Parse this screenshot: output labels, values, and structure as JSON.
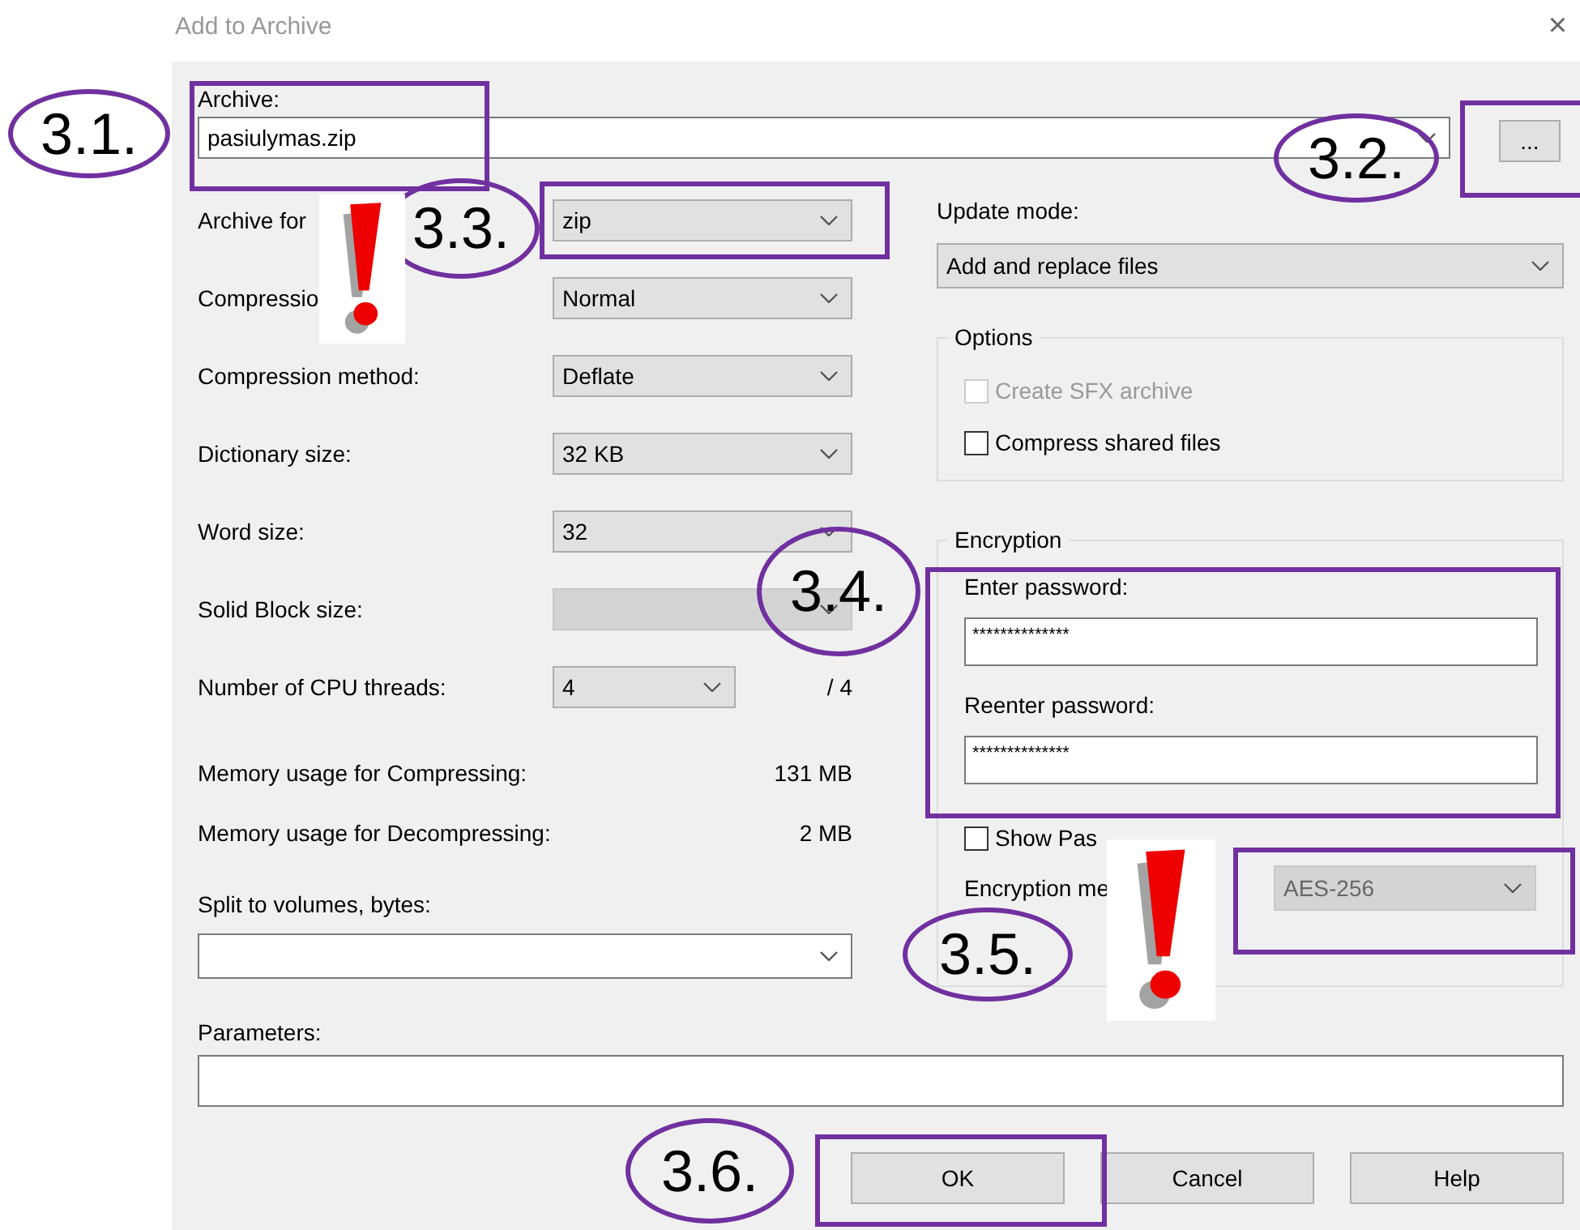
{
  "window": {
    "title": "Add to Archive",
    "close": "×"
  },
  "archive": {
    "label": "Archive:",
    "value": "pasiulymas.zip",
    "browse": "..."
  },
  "settings": [
    {
      "kind": "combo",
      "label": "Archive for",
      "value": "zip",
      "disabled": false
    },
    {
      "kind": "combo",
      "label": "Compressio",
      "value": "Normal",
      "disabled": false
    },
    {
      "kind": "combo",
      "label": "Compression method:",
      "value": "Deflate",
      "disabled": false
    },
    {
      "kind": "combo",
      "label": "Dictionary size:",
      "value": "32 KB",
      "disabled": false
    },
    {
      "kind": "combo",
      "label": "Word size:",
      "value": "32",
      "disabled": false
    },
    {
      "kind": "combo",
      "label": "Solid Block size:",
      "disabled": true
    },
    {
      "kind": "threads",
      "label": "Number of CPU threads:",
      "value": "4",
      "suffix": "/ 4",
      "disabled": false
    },
    {
      "kind": "info",
      "label": "Memory usage for Compressing:",
      "value": "131 MB"
    },
    {
      "kind": "info",
      "label": "Memory usage for Decompressing:",
      "value": "2 MB"
    }
  ],
  "split": {
    "label": "Split to volumes, bytes:"
  },
  "parameters": {
    "label": "Parameters:"
  },
  "update_mode": {
    "label": "Update mode:",
    "value": "Add and replace files"
  },
  "options": {
    "title": "Options",
    "items": [
      {
        "label": "Create SFX archive",
        "checked": false,
        "disabled": true
      },
      {
        "label": "Compress shared files",
        "checked": false,
        "disabled": false
      }
    ]
  },
  "encryption": {
    "title": "Encryption",
    "password_label": "Enter password:",
    "password": "**************",
    "reenter_label": "Reenter password:",
    "reenter": "**************",
    "show_password": {
      "label": "Show Pas",
      "checked": false
    },
    "method_label": "Encryption me",
    "method": {
      "value": "AES-256",
      "disabled": true
    }
  },
  "buttons": [
    "OK",
    "Cancel",
    "Help"
  ],
  "annotations": [
    {
      "kind": "callout",
      "label": "3.1."
    },
    {
      "kind": "frame"
    },
    {
      "kind": "callout",
      "label": "3.2."
    },
    {
      "kind": "frame"
    },
    {
      "kind": "callout",
      "label": "3.3."
    },
    {
      "kind": "frame"
    },
    {
      "kind": "warning"
    },
    {
      "kind": "callout",
      "label": "3.4."
    },
    {
      "kind": "frame"
    },
    {
      "kind": "callout",
      "label": "3.5."
    },
    {
      "kind": "frame"
    },
    {
      "kind": "warning"
    },
    {
      "kind": "callout",
      "label": "3.6."
    },
    {
      "kind": "frame"
    }
  ]
}
